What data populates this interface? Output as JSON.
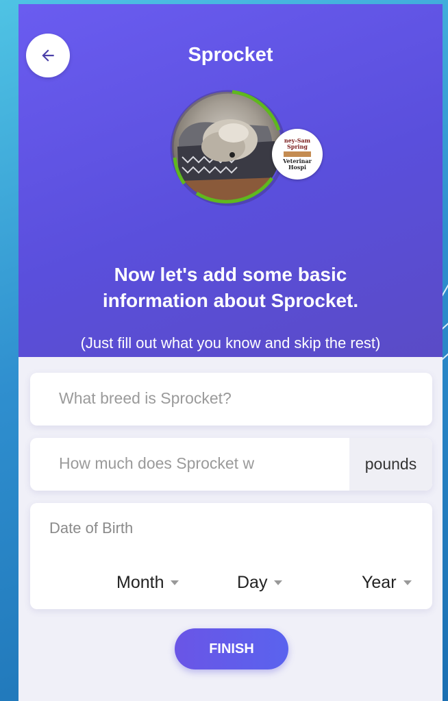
{
  "header": {
    "title": "Sprocket",
    "back_icon": "arrow-left-icon"
  },
  "vet_badge": {
    "line1": "ney-Sam",
    "line2": "Spring",
    "line3": "Veterinar",
    "line4": "Hospi"
  },
  "prompt": {
    "headline_line1": "Now let's add some basic",
    "headline_line2": "information about Sprocket.",
    "subline": "(Just fill out what you know and skip the rest)"
  },
  "form": {
    "breed_placeholder": "What breed is Sprocket?",
    "weight_placeholder": "How much does Sprocket w",
    "weight_unit": "pounds",
    "dob_label": "Date of Birth",
    "month": "Month",
    "day": "Day",
    "year": "Year"
  },
  "actions": {
    "finish_label": "FINISH"
  },
  "colors": {
    "primary": "#5a4fdc",
    "ring_green": "#5fb81e",
    "background": "#f0f0f8"
  }
}
